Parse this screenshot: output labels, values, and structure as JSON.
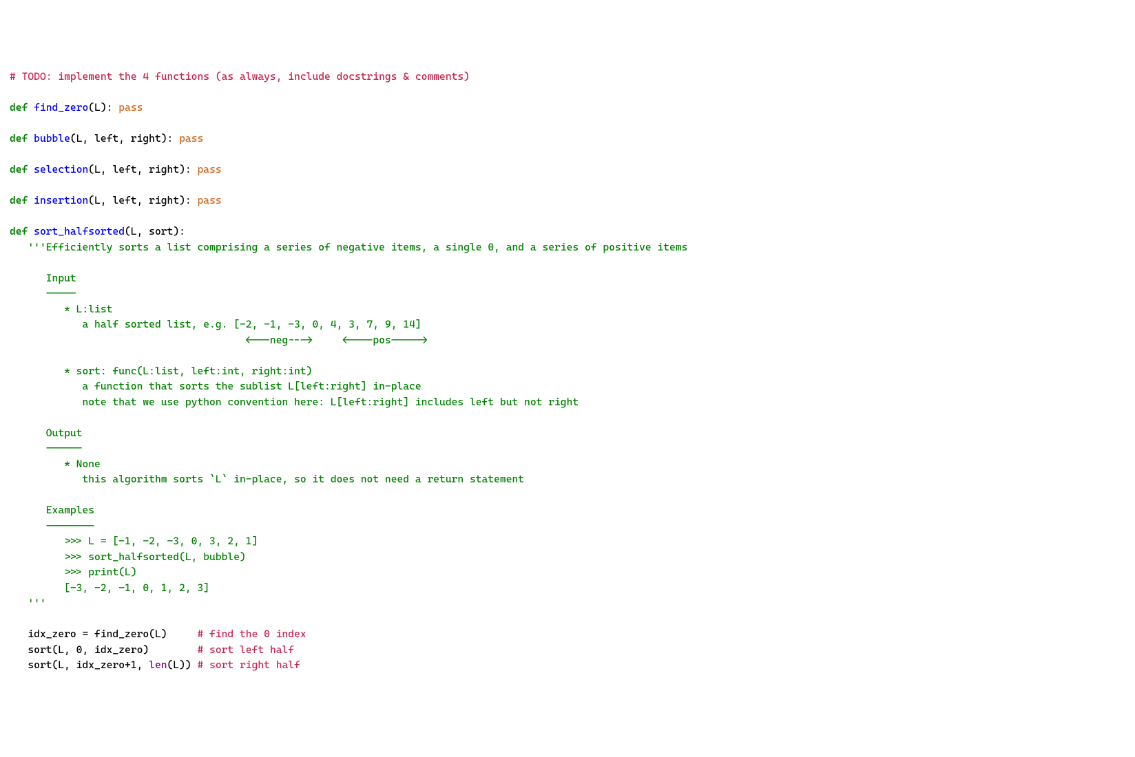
{
  "lines": [
    {
      "segments": [
        {
          "class": "c-comment",
          "text": "# TODO: implement the 4 functions (as always, include docstrings & comments)"
        }
      ]
    },
    {
      "segments": [
        {
          "class": "c-default",
          "text": ""
        }
      ]
    },
    {
      "segments": [
        {
          "class": "c-keyword",
          "text": "def"
        },
        {
          "class": "c-default",
          "text": " "
        },
        {
          "class": "c-funcname",
          "text": "find_zero"
        },
        {
          "class": "c-default",
          "text": "(L): "
        },
        {
          "class": "c-pass",
          "text": "pass"
        }
      ]
    },
    {
      "segments": [
        {
          "class": "c-default",
          "text": ""
        }
      ]
    },
    {
      "segments": [
        {
          "class": "c-keyword",
          "text": "def"
        },
        {
          "class": "c-default",
          "text": " "
        },
        {
          "class": "c-funcname",
          "text": "bubble"
        },
        {
          "class": "c-default",
          "text": "(L, left, right): "
        },
        {
          "class": "c-pass",
          "text": "pass"
        }
      ]
    },
    {
      "segments": [
        {
          "class": "c-default",
          "text": ""
        }
      ]
    },
    {
      "segments": [
        {
          "class": "c-keyword",
          "text": "def"
        },
        {
          "class": "c-default",
          "text": " "
        },
        {
          "class": "c-funcname",
          "text": "selection"
        },
        {
          "class": "c-default",
          "text": "(L, left, right): "
        },
        {
          "class": "c-pass",
          "text": "pass"
        }
      ]
    },
    {
      "segments": [
        {
          "class": "c-default",
          "text": ""
        }
      ]
    },
    {
      "segments": [
        {
          "class": "c-keyword",
          "text": "def"
        },
        {
          "class": "c-default",
          "text": " "
        },
        {
          "class": "c-funcname",
          "text": "insertion"
        },
        {
          "class": "c-default",
          "text": "(L, left, right): "
        },
        {
          "class": "c-pass",
          "text": "pass"
        }
      ]
    },
    {
      "segments": [
        {
          "class": "c-default",
          "text": ""
        }
      ]
    },
    {
      "segments": [
        {
          "class": "c-keyword",
          "text": "def"
        },
        {
          "class": "c-default",
          "text": " "
        },
        {
          "class": "c-funcname",
          "text": "sort_halfsorted"
        },
        {
          "class": "c-default",
          "text": "(L, sort):"
        }
      ]
    },
    {
      "segments": [
        {
          "class": "c-default",
          "text": "   "
        },
        {
          "class": "c-docstring",
          "text": "'''Efficiently sorts a list comprising a series of negative items, a single 0, and a series of positive items"
        }
      ]
    },
    {
      "segments": [
        {
          "class": "c-default",
          "text": ""
        }
      ]
    },
    {
      "segments": [
        {
          "class": "c-docstring",
          "text": "      Input"
        }
      ]
    },
    {
      "segments": [
        {
          "class": "c-docstring",
          "text": "      -----"
        }
      ]
    },
    {
      "segments": [
        {
          "class": "c-docstring",
          "text": "         * L:list"
        }
      ]
    },
    {
      "segments": [
        {
          "class": "c-docstring",
          "text": "            a half sorted list, e.g. [-2, -1, -3, 0, 4, 3, 7, 9, 14]"
        }
      ]
    },
    {
      "segments": [
        {
          "class": "c-docstring",
          "text": "                                       <---neg--->     <----pos----->"
        }
      ]
    },
    {
      "segments": [
        {
          "class": "c-default",
          "text": ""
        }
      ]
    },
    {
      "segments": [
        {
          "class": "c-docstring",
          "text": "         * sort: func(L:list, left:int, right:int)"
        }
      ]
    },
    {
      "segments": [
        {
          "class": "c-docstring",
          "text": "            a function that sorts the sublist L[left:right] in-place"
        }
      ]
    },
    {
      "segments": [
        {
          "class": "c-docstring",
          "text": "            note that we use python convention here: L[left:right] includes left but not right"
        }
      ]
    },
    {
      "segments": [
        {
          "class": "c-default",
          "text": ""
        }
      ]
    },
    {
      "segments": [
        {
          "class": "c-docstring",
          "text": "      Output"
        }
      ]
    },
    {
      "segments": [
        {
          "class": "c-docstring",
          "text": "      ------"
        }
      ]
    },
    {
      "segments": [
        {
          "class": "c-docstring",
          "text": "         * None"
        }
      ]
    },
    {
      "segments": [
        {
          "class": "c-docstring",
          "text": "            this algorithm sorts `L` in-place, so it does not need a return statement"
        }
      ]
    },
    {
      "segments": [
        {
          "class": "c-default",
          "text": ""
        }
      ]
    },
    {
      "segments": [
        {
          "class": "c-docstring",
          "text": "      Examples"
        }
      ]
    },
    {
      "segments": [
        {
          "class": "c-docstring",
          "text": "      --------"
        }
      ]
    },
    {
      "segments": [
        {
          "class": "c-docstring",
          "text": "         >>> L = [-1, -2, -3, 0, 3, 2, 1]"
        }
      ]
    },
    {
      "segments": [
        {
          "class": "c-docstring",
          "text": "         >>> sort_halfsorted(L, bubble)"
        }
      ]
    },
    {
      "segments": [
        {
          "class": "c-docstring",
          "text": "         >>> print(L)"
        }
      ]
    },
    {
      "segments": [
        {
          "class": "c-docstring",
          "text": "         [-3, -2, -1, 0, 1, 2, 3]"
        }
      ]
    },
    {
      "segments": [
        {
          "class": "c-default",
          "text": "   "
        },
        {
          "class": "c-docstring",
          "text": "'''"
        }
      ]
    },
    {
      "segments": [
        {
          "class": "c-default",
          "text": ""
        }
      ]
    },
    {
      "segments": [
        {
          "class": "c-default",
          "text": "   idx_zero = find_zero(L)     "
        },
        {
          "class": "c-comment",
          "text": "# find the 0 index"
        }
      ]
    },
    {
      "segments": [
        {
          "class": "c-default",
          "text": "   sort(L, 0, idx_zero)        "
        },
        {
          "class": "c-comment",
          "text": "# sort left half"
        }
      ]
    },
    {
      "segments": [
        {
          "class": "c-default",
          "text": "   sort(L, idx_zero+1, "
        },
        {
          "class": "c-builtin",
          "text": "len"
        },
        {
          "class": "c-default",
          "text": "(L)) "
        },
        {
          "class": "c-comment",
          "text": "# sort right half"
        }
      ]
    }
  ]
}
